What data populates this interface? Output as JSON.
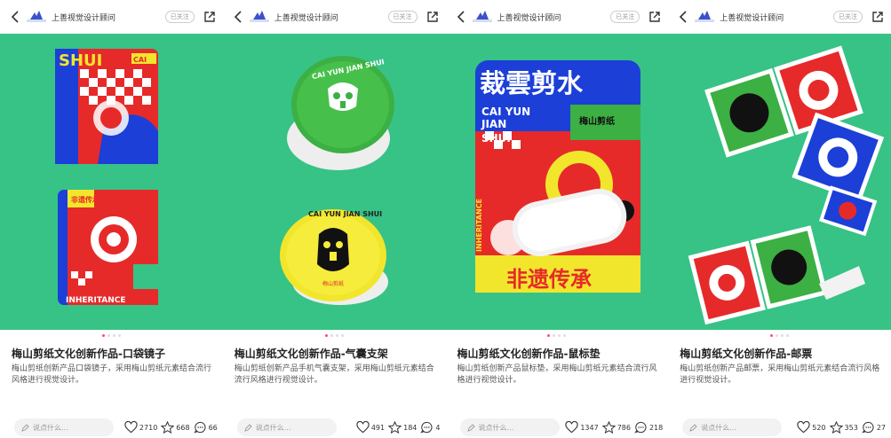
{
  "panels": [
    {
      "account": "上善视觉设计顾问",
      "follow": "已关注",
      "title": "梅山剪纸文化创新作品-口袋镜子",
      "description": "梅山剪纸创新产品口袋镜子，采用梅山剪纸元素结合流行风格进行视觉设计。",
      "comment_placeholder": "说点什么...",
      "likes": "2710",
      "collects": "668",
      "comments": "66",
      "image_text": [
        "SHUI",
        "CAI",
        "INHERITANCE",
        "非遗传承"
      ]
    },
    {
      "account": "上善视觉设计顾问",
      "follow": "已关注",
      "title": "梅山剪纸文化创新作品-气囊支架",
      "description": "梅山剪纸创新产品手机气囊支架，采用梅山剪纸元素结合流行风格进行视觉设计。",
      "comment_placeholder": "说点什么...",
      "likes": "491",
      "collects": "184",
      "comments": "4",
      "image_text": [
        "CAI YUN JIAN SHUI",
        "CAI YUN JIAN SHUI",
        "梅山剪纸"
      ]
    },
    {
      "account": "上善视觉设计顾问",
      "follow": "已关注",
      "title": "梅山剪纸文化创新作品-鼠标垫",
      "description": "梅山剪纸创新产品鼠标垫，采用梅山剪纸元素结合流行风格进行视觉设计。",
      "comment_placeholder": "说点什么...",
      "likes": "1347",
      "collects": "786",
      "comments": "218",
      "image_text": [
        "裁雲剪水",
        "CAI YUN",
        "JIAN",
        "SHUI",
        "梅山剪纸",
        "INHERITANCE",
        "非遗传承"
      ]
    },
    {
      "account": "上善视觉设计顾问",
      "follow": "已关注",
      "title": "梅山剪纸文化创新作品-邮票",
      "description": "梅山剪纸创新产品邮票，采用梅山剪纸元素结合流行风格进行视觉设计。",
      "comment_placeholder": "说点什么...",
      "likes": "520",
      "collects": "353",
      "comments": "27",
      "image_text": []
    }
  ],
  "colors": {
    "image_bg": "#37c286",
    "accent_red": "#e62a2a",
    "accent_blue": "#1c3fd8",
    "accent_yellow": "#f1e62c",
    "dot_active": "#ff4d6d"
  }
}
